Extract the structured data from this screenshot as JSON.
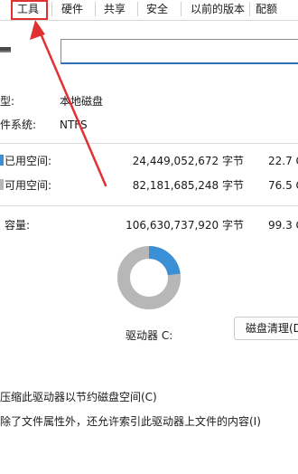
{
  "tabs": [
    {
      "label": "工具"
    },
    {
      "label": "硬件"
    },
    {
      "label": "共享"
    },
    {
      "label": "安全"
    },
    {
      "label": "以前的版本"
    },
    {
      "label": "配额"
    }
  ],
  "general": {
    "name_value": "",
    "type_label": "型:",
    "type_value": "本地磁盘",
    "fs_label": "件系统:",
    "fs_value": "NTFS"
  },
  "usage": {
    "used_label": "已用空间:",
    "used_bytes": "24,449,052,672 字节",
    "used_short": "22.7 G",
    "used_color": "#3b8fd6",
    "free_label": "可用空间:",
    "free_bytes": "82,181,685,248 字节",
    "free_short": "76.5 G",
    "free_color": "#b7b7b7",
    "capacity_label": "容量:",
    "capacity_bytes": "106,630,737,920 字节",
    "capacity_short": "99.3 G",
    "used_fraction": 0.229
  },
  "drive_label": "驱动器 C:",
  "cleanup_button": "磁盘清理(D",
  "options": {
    "compress": "压缩此驱动器以节约磁盘空间(C)",
    "index": "除了文件属性外，还允许索引此驱动器上文件的内容(I)"
  }
}
